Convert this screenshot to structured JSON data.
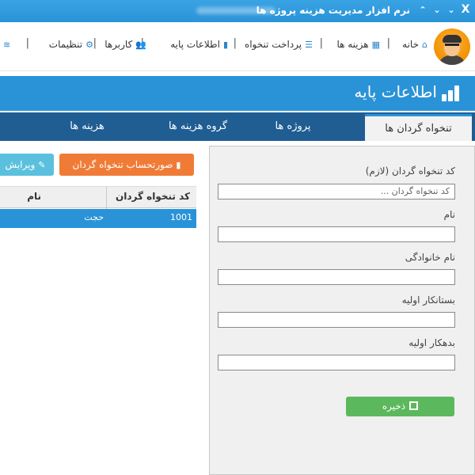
{
  "window": {
    "title": "نرم افزار مدیریت هزینه پروژه ها",
    "close": "X"
  },
  "nav": {
    "items": [
      {
        "label": "خانه",
        "icon": "home-icon"
      },
      {
        "label": "هزینه ها",
        "icon": "grid-icon"
      },
      {
        "label": "پرداخت تنخواه",
        "icon": "list-icon"
      },
      {
        "label": "اطلاعات پایه",
        "icon": "bar-chart-icon"
      },
      {
        "label": "کاربرها",
        "icon": "users-icon"
      },
      {
        "label": "تنظیمات",
        "icon": "gear-icon"
      }
    ]
  },
  "page": {
    "title": "اطلاعات پایه"
  },
  "tabs": [
    {
      "label": "تنخواه گردان ها",
      "active": true
    },
    {
      "label": "پروژه ها",
      "active": false
    },
    {
      "label": "گروه هزینه ها",
      "active": false
    },
    {
      "label": "هزینه ها",
      "active": false
    }
  ],
  "form": {
    "code_label": "کد تنخواه گردان (لازم)",
    "code_placeholder": "کد تنخواه گردان ...",
    "name_label": "نام",
    "family_label": "نام خانوادگی",
    "creditor_label": "بستانکار اولیه",
    "debtor_label": "بدهکار اولیه",
    "save_label": "ذخیره"
  },
  "actions": {
    "statement_label": "صورتحساب تنخواه گردان",
    "edit_label": "ویرایش"
  },
  "grid": {
    "columns": [
      "کد تنخواه گردان",
      "نام"
    ],
    "rows": [
      {
        "code": "1001",
        "name": "حجت"
      }
    ]
  },
  "colors": {
    "primary": "#2a93d7",
    "tabbar": "#1f5d93",
    "save": "#5cb85c",
    "statement": "#f07b37",
    "edit": "#5bc0de"
  }
}
